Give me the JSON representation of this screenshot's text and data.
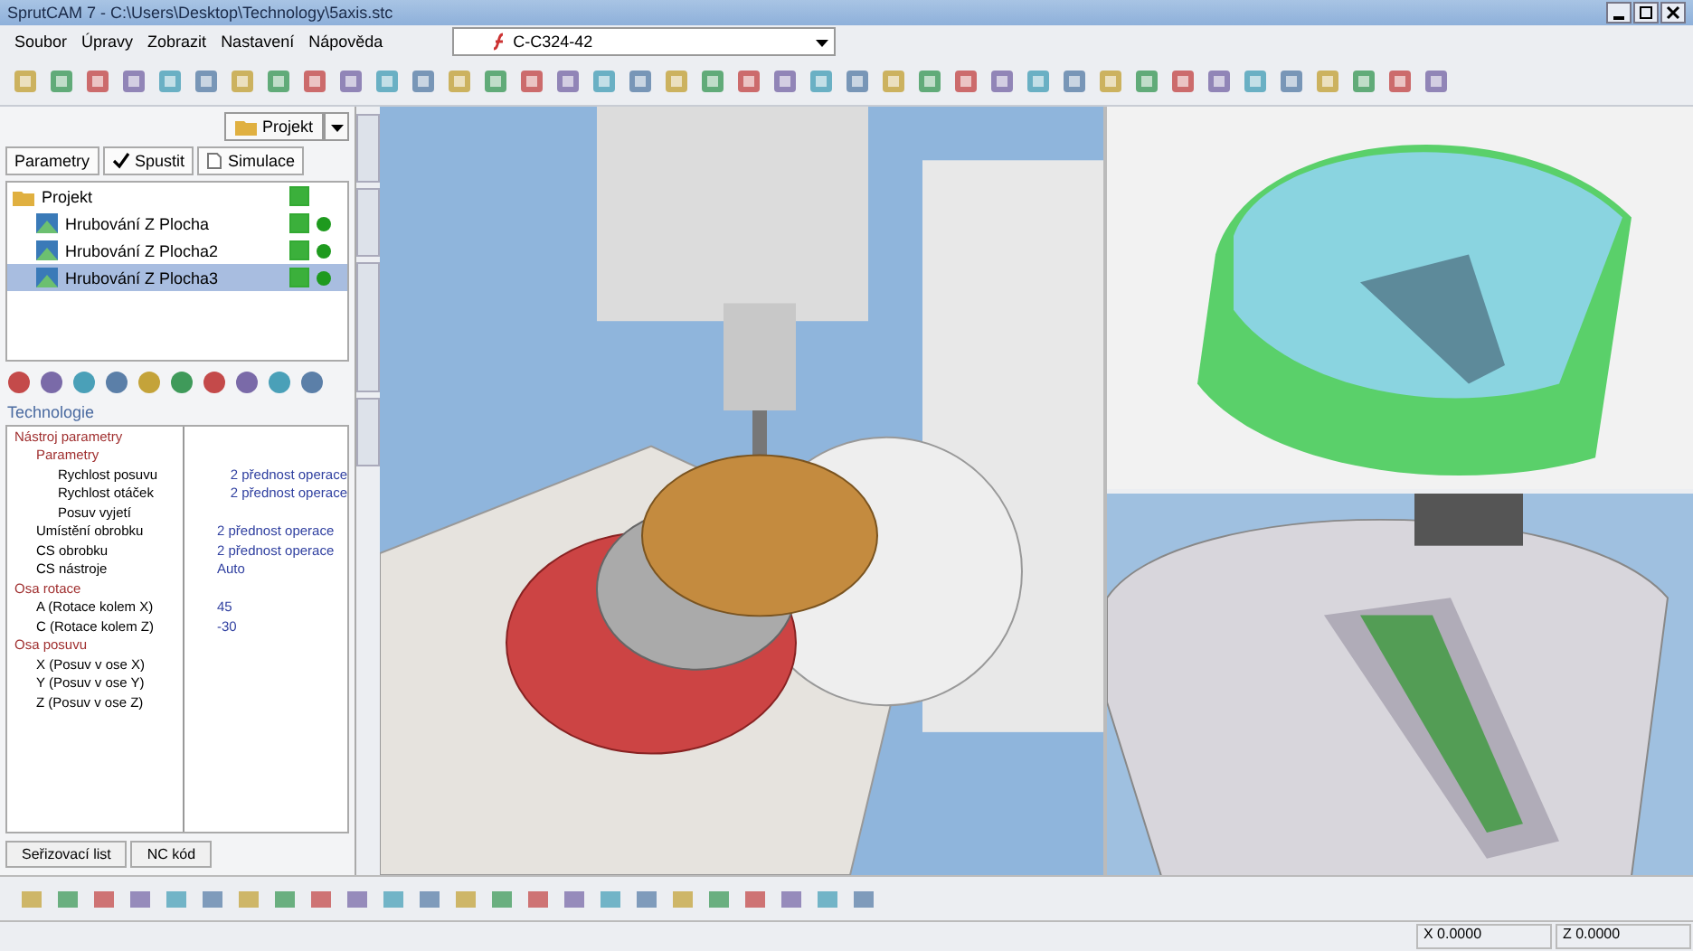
{
  "window": {
    "title": "SprutCAM 7 - C:\\Users\\Desktop\\Technology\\5axis.stc"
  },
  "menu": [
    "Soubor",
    "Úpravy",
    "Zobrazit",
    "Nastavení",
    "Nápověda"
  ],
  "part_combo": {
    "value": "C-C324-42"
  },
  "operations_panel": {
    "folder_button": "Projekt",
    "buttons": [
      {
        "label": "Parametry",
        "kind": "plain"
      },
      {
        "label": "Spustit",
        "kind": "check"
      },
      {
        "label": "Simulace",
        "kind": "page"
      }
    ],
    "tree": [
      {
        "label": "Projekt",
        "checked": true,
        "selected": false,
        "children": [
          {
            "label": "Hrubování Z Plocha",
            "checked": true,
            "selected": false,
            "color": "#1e9a1e"
          },
          {
            "label": "Hrubování Z Plocha2",
            "checked": true,
            "selected": false,
            "color": "#1e9a1e"
          },
          {
            "label": "Hrubování Z Plocha3",
            "checked": true,
            "selected": true,
            "color": "#1e9a1e"
          }
        ]
      }
    ]
  },
  "technology_label": "Technologie",
  "properties": [
    {
      "label": "Nástroj parametry",
      "children": [
        {
          "label": "Parametry",
          "children": [
            {
              "label": "Rychlost posuvu",
              "value": "2 přednost operace"
            },
            {
              "label": "Rychlost otáček",
              "value": "2 přednost operace"
            },
            {
              "label": "Posuv vyjetí"
            }
          ]
        },
        {
          "label": "Umístění obrobku",
          "value": "2 přednost operace"
        },
        {
          "label": "CS obrobku",
          "value": "2 přednost operace"
        },
        {
          "label": "CS nástroje",
          "value": "Auto"
        }
      ]
    },
    {
      "label": "Osa rotace",
      "children": [
        {
          "label": "A (Rotace kolem X)",
          "value": "45"
        },
        {
          "label": "C (Rotace kolem Z)",
          "value": "-30"
        }
      ]
    },
    {
      "label": "Osa posuvu",
      "children": [
        {
          "label": "X (Posuv v ose X)"
        },
        {
          "label": "Y (Posuv v ose Y)"
        },
        {
          "label": "Z (Posuv v ose Z)"
        }
      ]
    }
  ],
  "bottom_tabs": [
    {
      "label": "Seřizovací list",
      "selected": false
    },
    {
      "label": "NC kód",
      "selected": false
    }
  ],
  "status_bar": {
    "x": "X 0.0000",
    "z": "Z 0.0000"
  }
}
